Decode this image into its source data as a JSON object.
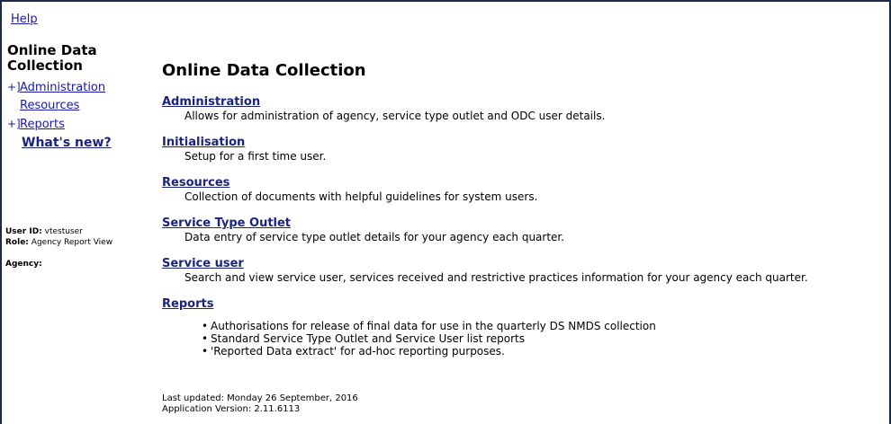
{
  "header": {
    "help_label": "Help"
  },
  "sidebar": {
    "title_line1": "Online Data",
    "title_line2": "Collection",
    "items": [
      {
        "expander": "+]",
        "label": "Administration"
      },
      {
        "expander": "",
        "label": "Resources"
      },
      {
        "expander": "+]",
        "label": "Reports"
      },
      {
        "expander": "",
        "label": "What's new?"
      }
    ],
    "user_id_label": "User ID:",
    "user_id_value": "vtestuser",
    "role_label": "Role:",
    "role_value": "Agency Report View",
    "agency_label": "Agency:"
  },
  "main": {
    "title": "Online Data Collection",
    "sections": [
      {
        "title": "Administration",
        "desc": "Allows for administration of agency, service type outlet and ODC user details."
      },
      {
        "title": "Initialisation",
        "desc": "Setup for a first time user."
      },
      {
        "title": "Resources",
        "desc": "Collection of documents with helpful guidelines for system users."
      },
      {
        "title": "Service Type Outlet",
        "desc": "Data entry of service type outlet details for your agency each quarter."
      },
      {
        "title": "Service user",
        "desc": "Search and view service user, services received and restrictive practices information for your agency each quarter."
      },
      {
        "title": "Reports",
        "desc": ""
      }
    ],
    "reports_bullets": [
      "Authorisations for release of final data for use in the quarterly DS NMDS collection",
      "Standard Service Type Outlet and Service User list reports",
      "'Reported Data extract' for ad-hoc reporting purposes."
    ]
  },
  "footer": {
    "last_updated": "Last updated: Monday 26 September, 2016",
    "app_version": "Application Version: 2.11.6113"
  },
  "colors": {
    "link": "#1a1aa6",
    "heading_link": "#1a237e",
    "border": "#1c2a4a"
  }
}
